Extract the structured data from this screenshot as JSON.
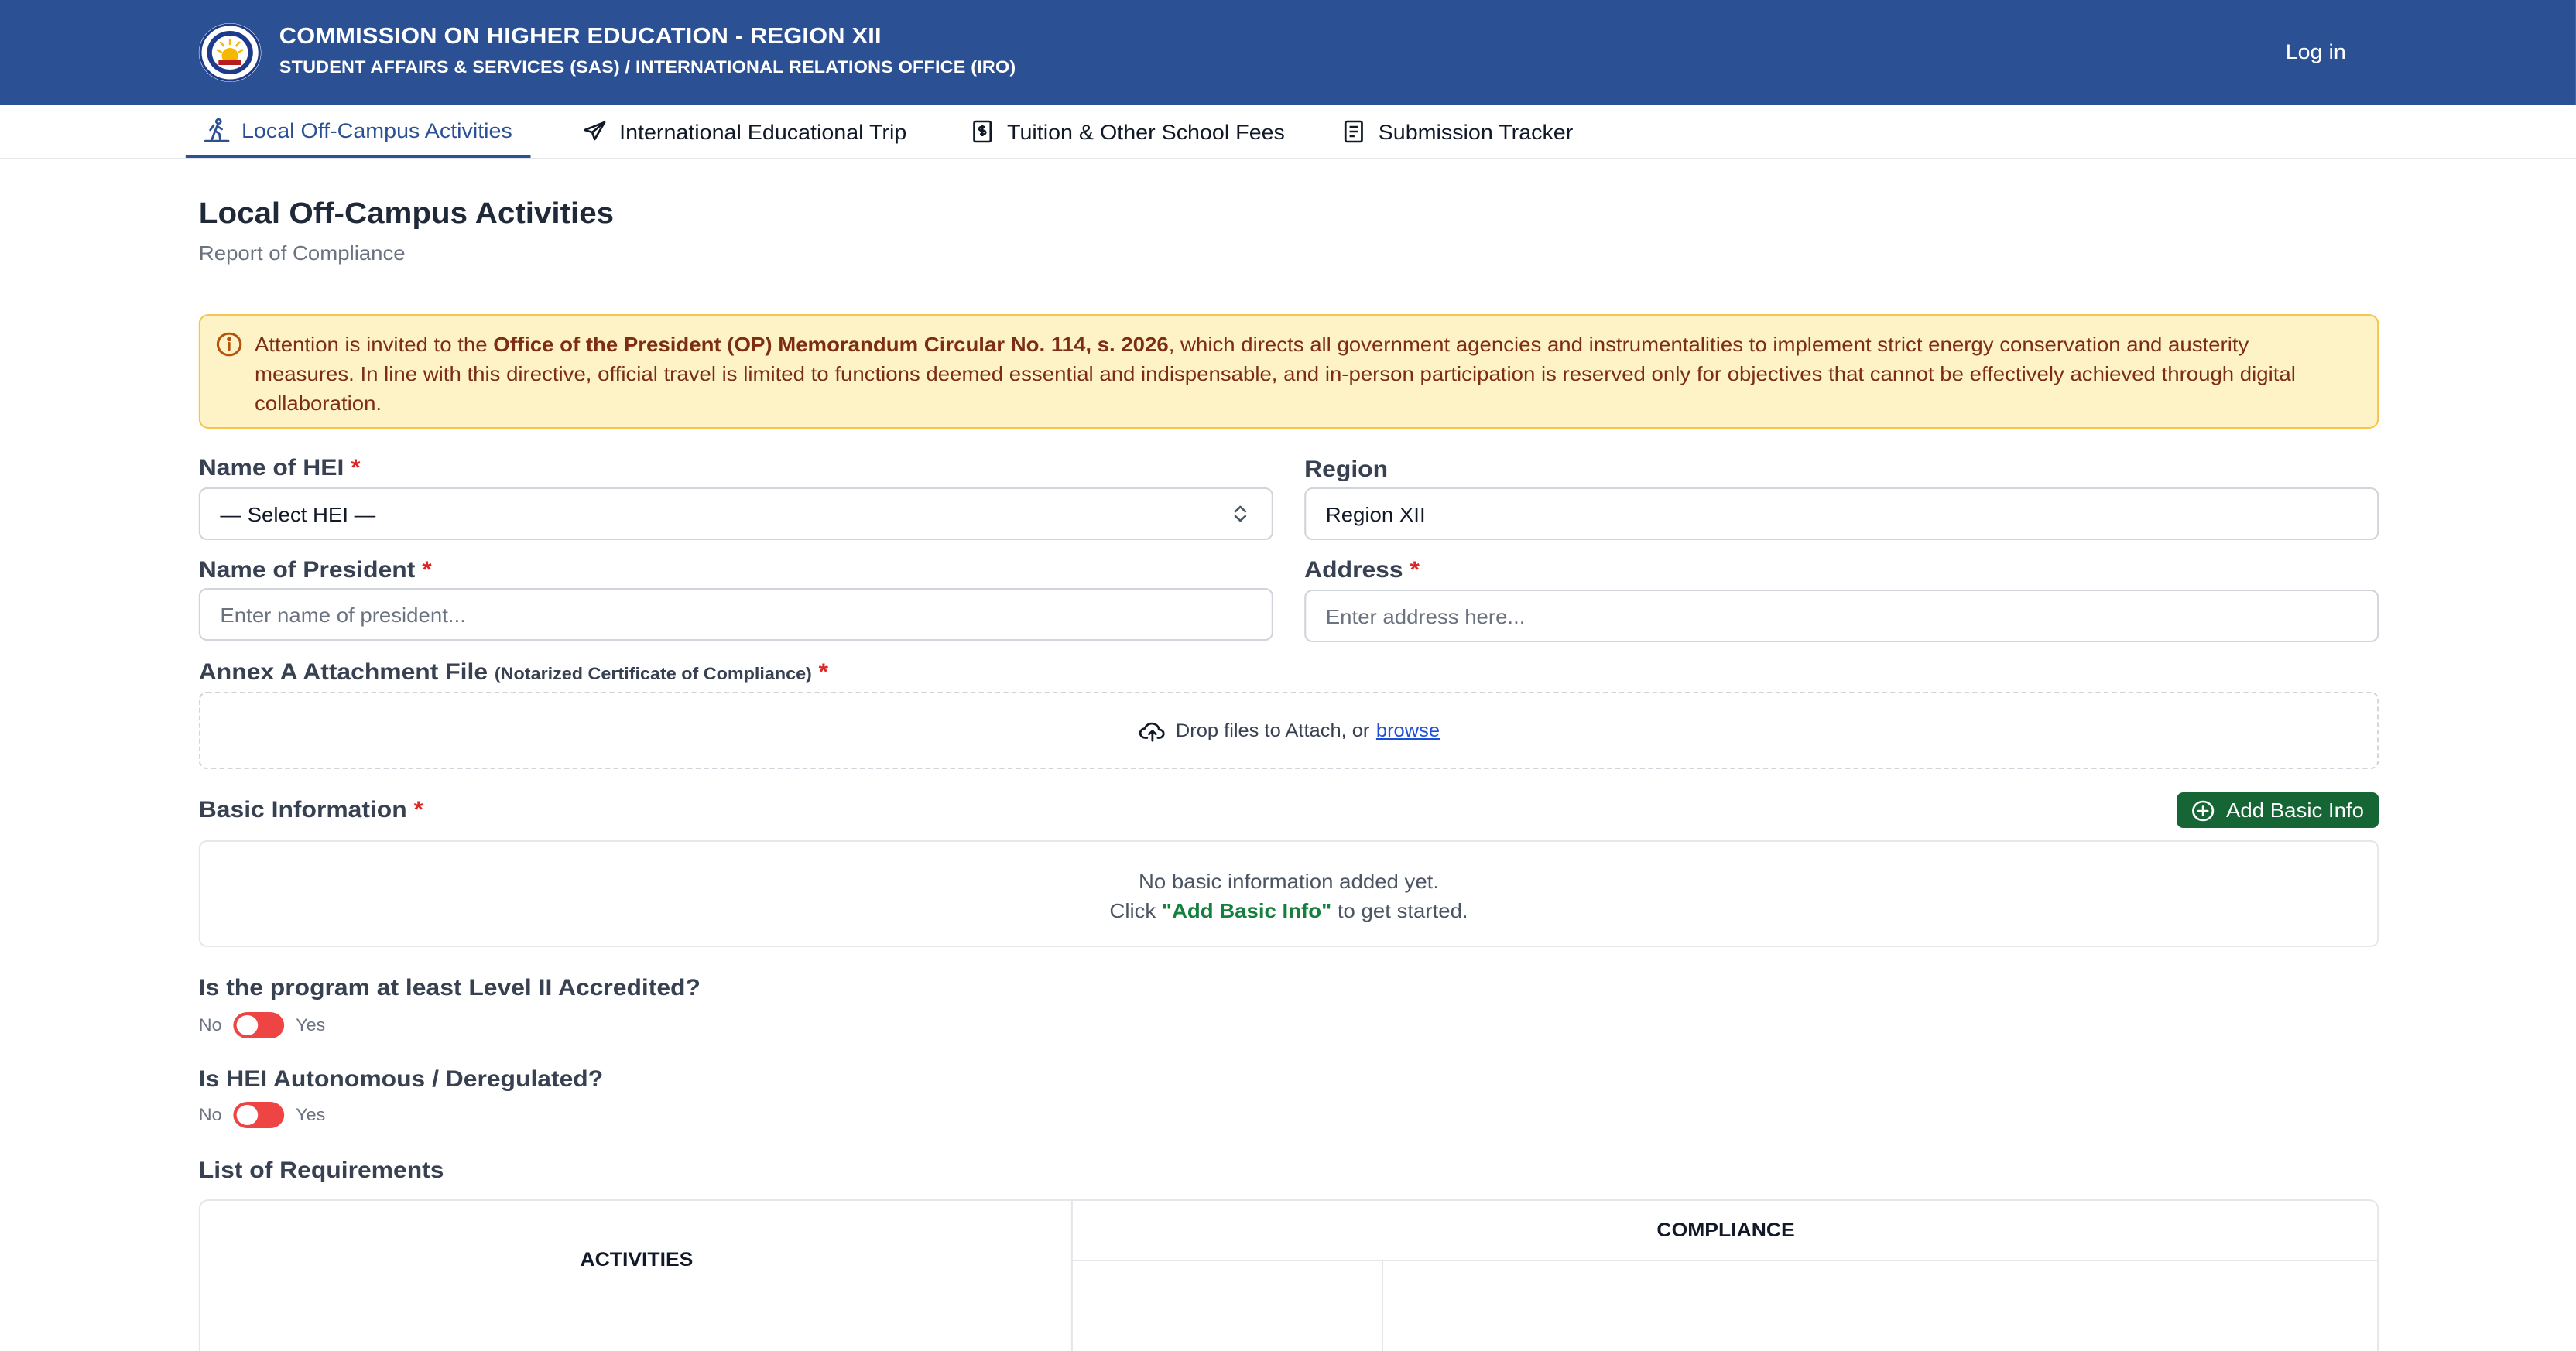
{
  "header": {
    "title": "COMMISSION ON HIGHER EDUCATION - REGION XII",
    "subtitle": "STUDENT AFFAIRS & SERVICES (SAS) / INTERNATIONAL RELATIONS OFFICE (IRO)",
    "login_label": "Log in",
    "brand_color": "#2b5094"
  },
  "tabs": [
    {
      "label": "Local Off-Campus Activities",
      "icon": "hiking-icon",
      "active": true
    },
    {
      "label": "International Educational Trip",
      "icon": "plane-icon",
      "active": false
    },
    {
      "label": "Tuition & Other School Fees",
      "icon": "receipt-icon",
      "active": false
    },
    {
      "label": "Submission Tracker",
      "icon": "document-list-icon",
      "active": false
    }
  ],
  "page": {
    "title": "Local Off-Campus Activities",
    "subtitle": "Report of Compliance"
  },
  "alert": {
    "prefix": "Attention is invited to the ",
    "bold": "Office of the President (OP) Memorandum Circular No. 114, s. 2026",
    "suffix": ", which directs all government agencies and instrumentalities to implement strict energy conservation and austerity measures. In line with this directive, official travel is limited to functions deemed essential and indispensable, and in-person participation is reserved only for objectives that cannot be effectively achieved through digital collaboration."
  },
  "form": {
    "hei_label": "Name of HEI",
    "hei_value": "— Select HEI —",
    "region_label": "Region",
    "region_value": "Region XII",
    "president_label": "Name of President",
    "president_placeholder": "Enter name of president...",
    "address_label": "Address",
    "address_placeholder": "Enter address here...",
    "required_mark": "*",
    "annex_label": "Annex A Attachment File",
    "annex_note": "(Notarized Certificate of Compliance)",
    "drop_text": "Drop files to Attach, or",
    "browse_label": "browse"
  },
  "basic_info": {
    "label": "Basic Information",
    "add_button": "Add Basic Info",
    "empty_line1": "No basic information added yet.",
    "empty_click": "Click ",
    "empty_bold": "\"Add Basic Info\"",
    "empty_suffix": " to get started."
  },
  "questions": [
    {
      "label": "Is the program at least Level II Accredited?",
      "no": "No",
      "yes": "Yes"
    },
    {
      "label": "Is HEI Autonomous / Deregulated?",
      "no": "No",
      "yes": "Yes"
    }
  ],
  "requirements": {
    "label": "List of Requirements",
    "col_activities": "ACTIVITIES",
    "col_compliance": "COMPLIANCE"
  }
}
